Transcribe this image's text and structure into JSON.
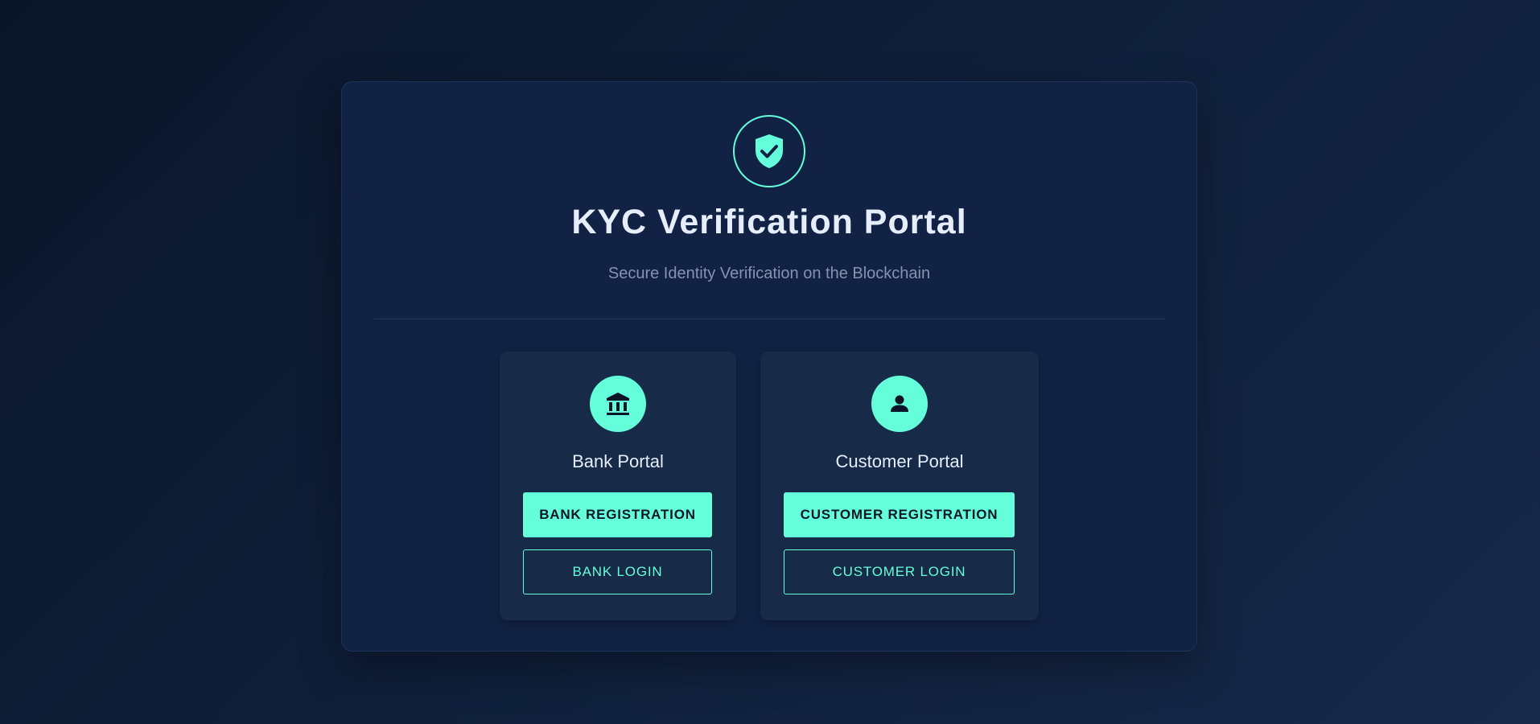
{
  "header": {
    "logo_icon": "shield-check-icon",
    "title": "KYC Verification Portal",
    "subtitle": "Secure Identity Verification on the Blockchain"
  },
  "portals": {
    "bank": {
      "icon": "bank-icon",
      "title": "Bank Portal",
      "register_label": "BANK REGISTRATION",
      "login_label": "BANK LOGIN"
    },
    "customer": {
      "icon": "user-icon",
      "title": "Customer Portal",
      "register_label": "CUSTOMER REGISTRATION",
      "login_label": "CUSTOMER LOGIN"
    }
  },
  "colors": {
    "accent": "#64ffda",
    "background": "#0f1f3a",
    "card": "#112244",
    "panel": "#172a48",
    "title_text": "#e6eefc",
    "muted_text": "#8892b0"
  }
}
